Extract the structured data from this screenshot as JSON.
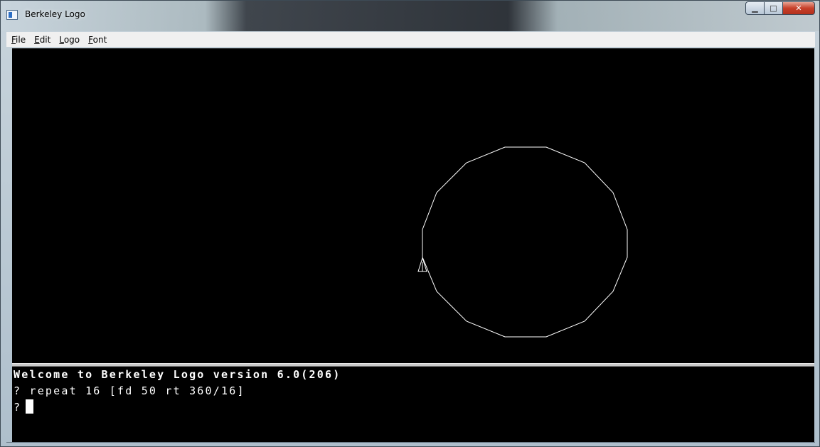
{
  "window": {
    "title": "Berkeley Logo",
    "controls": [
      "minimize",
      "maximize",
      "close"
    ]
  },
  "menu": [
    {
      "accel": "F",
      "rest": "ile"
    },
    {
      "accel": "E",
      "rest": "dit"
    },
    {
      "accel": "L",
      "rest": "ogo"
    },
    {
      "accel": "F",
      "rest": "ont"
    }
  ],
  "graphics": {
    "background": "#000000",
    "pen_color": "#ffffff",
    "polygon_sides": 16,
    "turtle": "turtle-triangle-icon"
  },
  "console": {
    "welcome": "Welcome to Berkeley Logo version 6.0(206)",
    "line1": "? repeat 16 [fd 50 rt 360/16]",
    "prompt": "?"
  }
}
